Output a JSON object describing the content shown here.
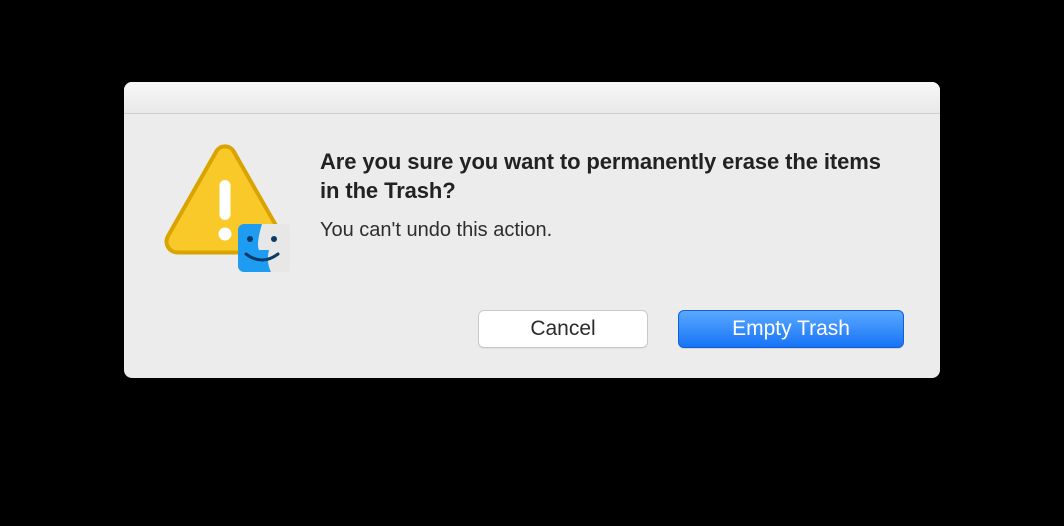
{
  "dialog": {
    "headline": "Are you sure you want to permanently erase the items in the Trash?",
    "subtext": "You can't undo this action.",
    "cancel_label": "Cancel",
    "confirm_label": "Empty Trash"
  }
}
